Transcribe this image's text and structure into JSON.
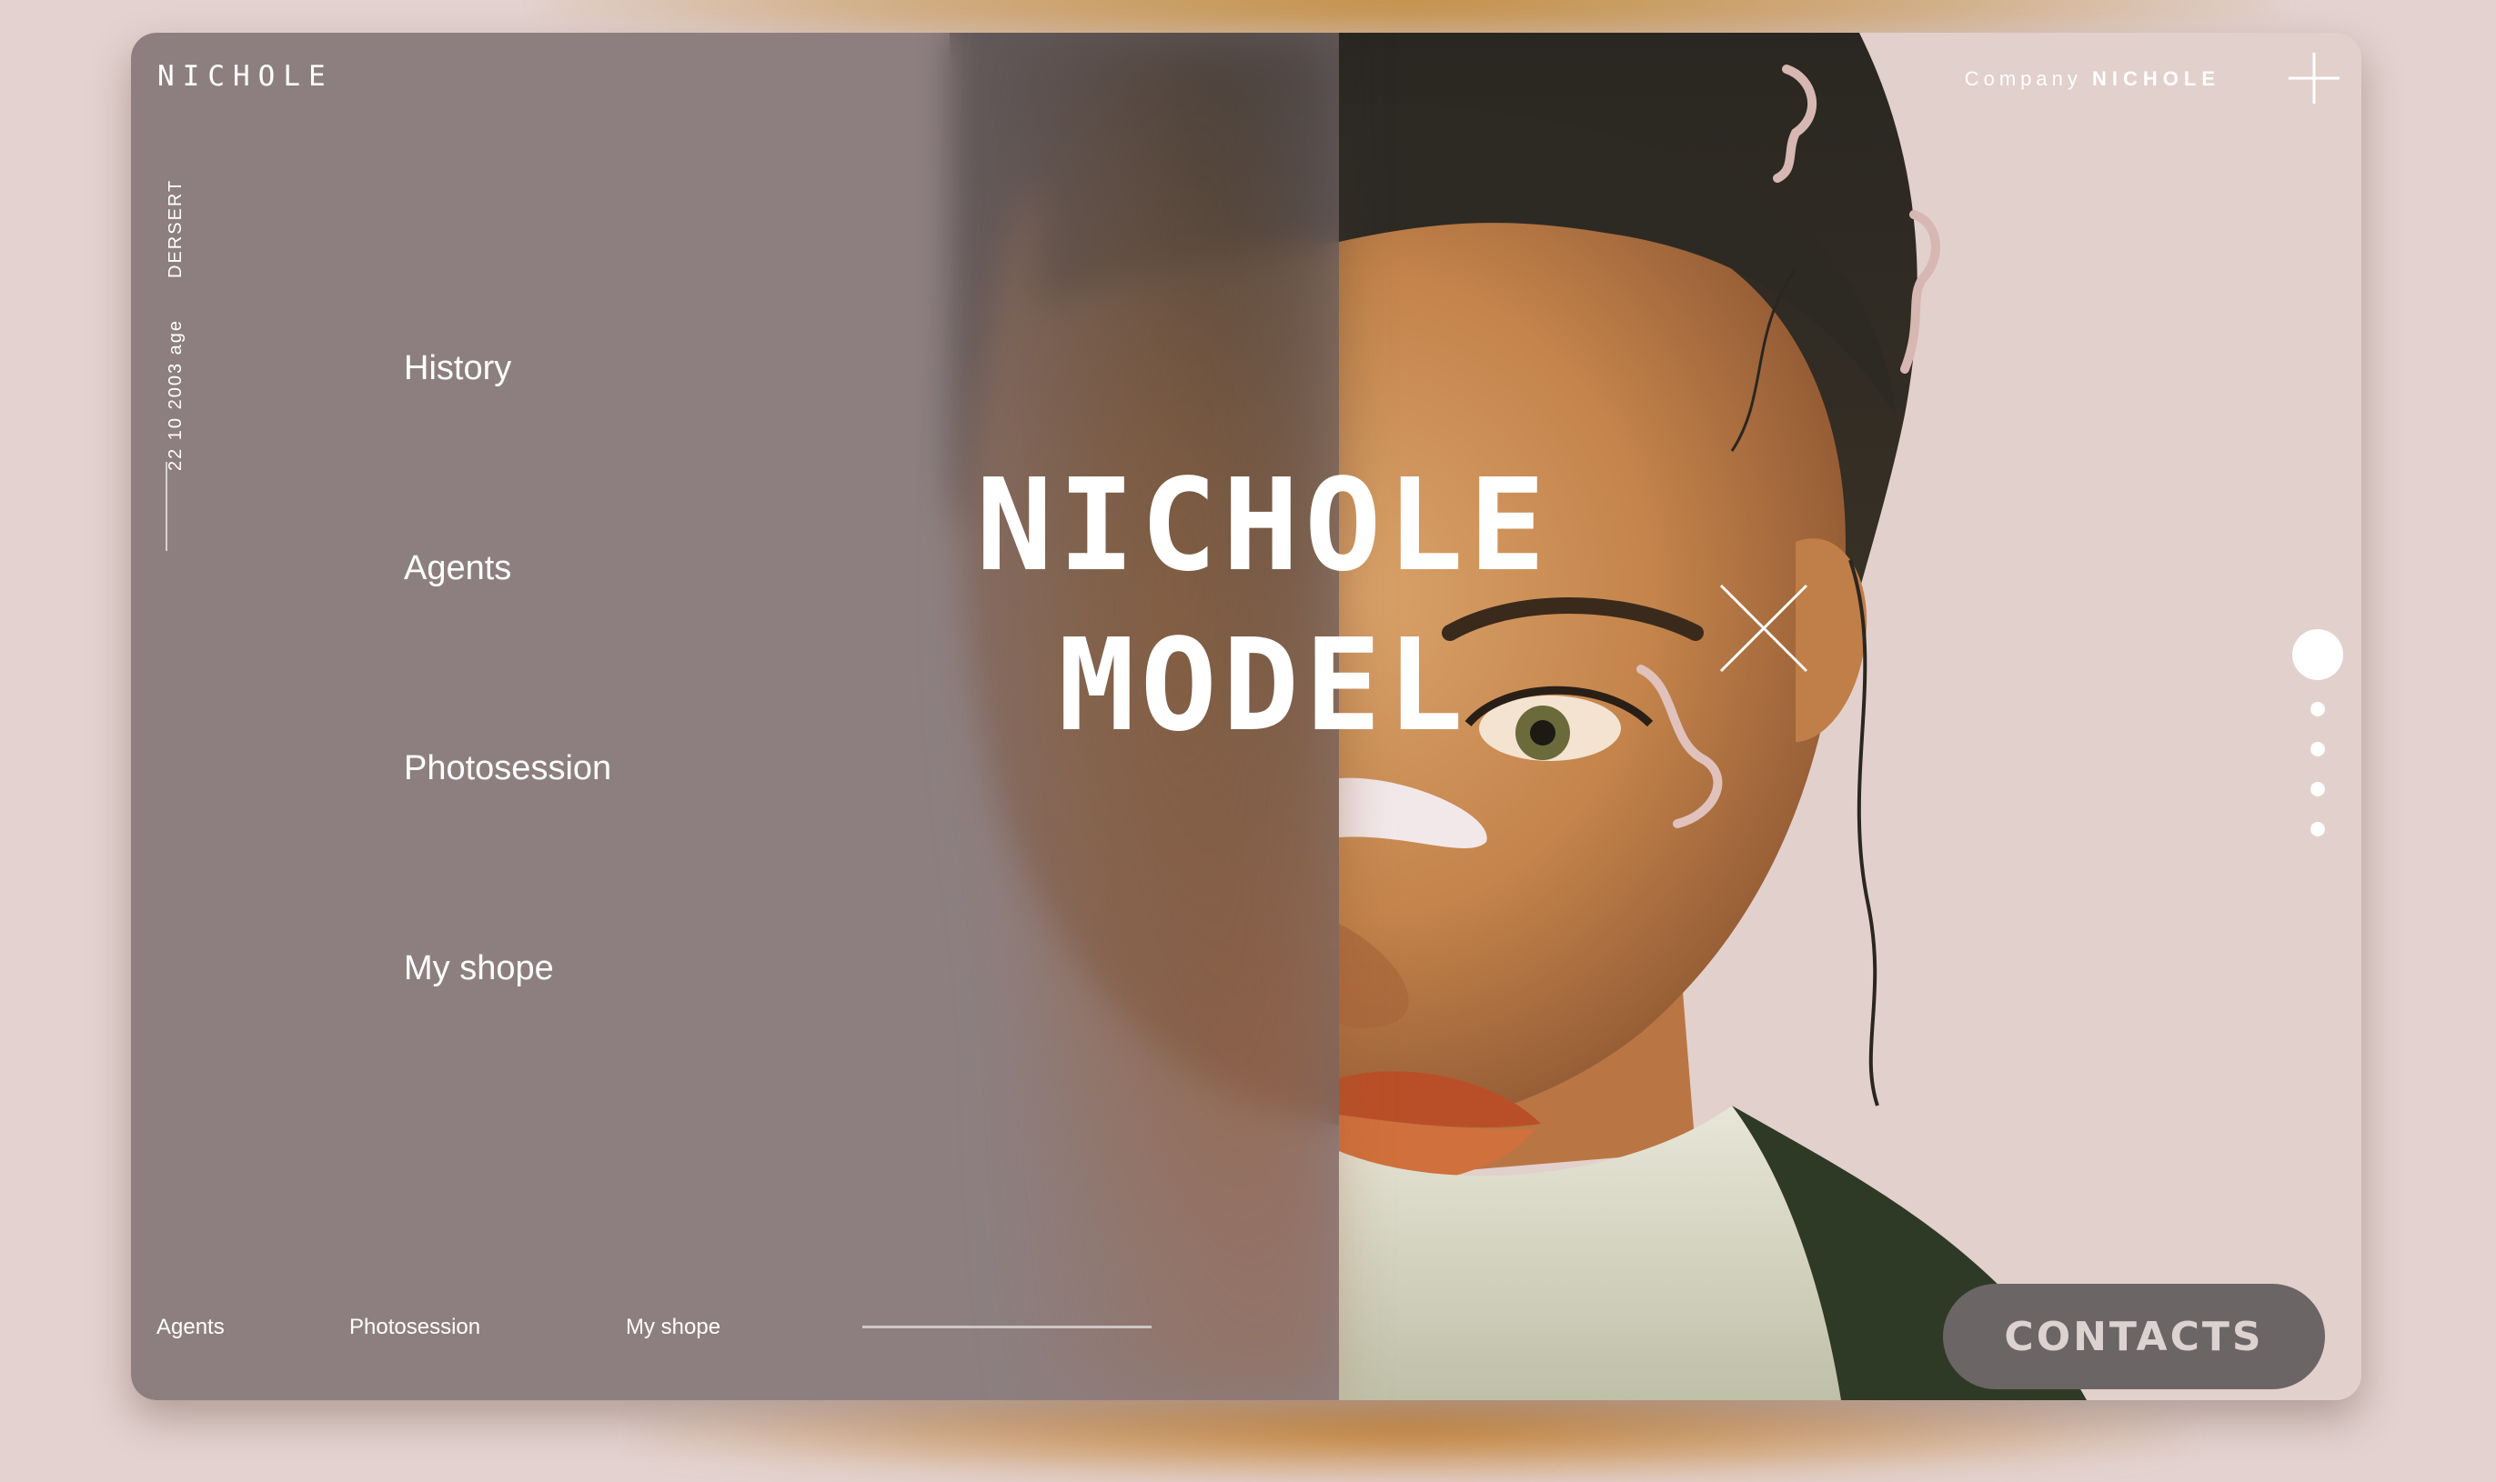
{
  "brand": {
    "logo": "NICHOLE"
  },
  "sidebar": {
    "vertical_text_1": "DERSERT",
    "vertical_text_2": "22 10 2003 age"
  },
  "menu": {
    "items": [
      {
        "label": "History"
      },
      {
        "label": "Agents"
      },
      {
        "label": "Photosession"
      },
      {
        "label": "My shope"
      }
    ]
  },
  "hero": {
    "line1": "NICHOLE",
    "line2": "MODEL"
  },
  "header": {
    "company_prefix": "Company",
    "company_name": "NICHOLE",
    "plus_icon": "plus-icon"
  },
  "overlay": {
    "close_icon": "close-icon"
  },
  "pager": {
    "total": 5,
    "active_index": 0
  },
  "footer": {
    "links": [
      {
        "label": "Agents"
      },
      {
        "label": "Photosession"
      },
      {
        "label": "My shope"
      }
    ],
    "contacts_label": "CONTACTS"
  },
  "colors": {
    "background": "#e3d2cf",
    "overlay": "#74686a",
    "contacts_button": "#6b6566",
    "text": "#ffffff"
  }
}
